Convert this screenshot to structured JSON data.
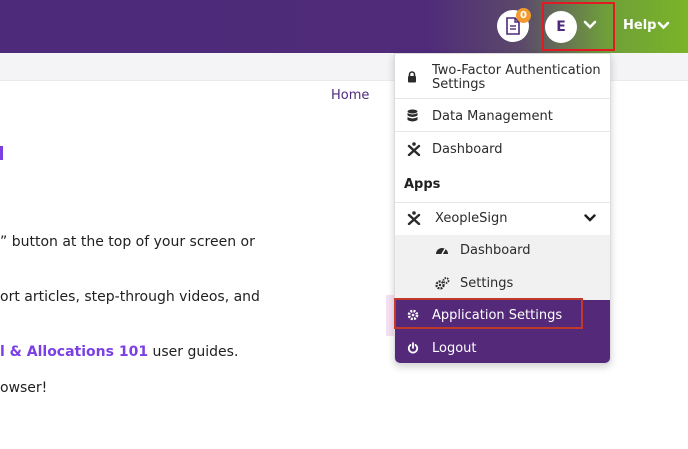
{
  "topbar": {
    "notification_count": "0",
    "user_initial": "E",
    "help_label": "Help",
    "colors": {
      "purple": "#4e2a7a",
      "green": "#7ab428",
      "badge": "#f29a2e",
      "highlight_border": "#e01b24"
    },
    "icons": [
      "document-icon",
      "chevron-down-icon"
    ]
  },
  "breadcrumb": {
    "home": "Home"
  },
  "content": {
    "line1": "” button at the top of your screen or",
    "line2": "ort articles, step-through videos, and",
    "line3_link": "l & Allocations 101",
    "line3_rest": " user guides.",
    "line4": "owser!"
  },
  "menu": {
    "two_factor": "Two-Factor Authentication Settings",
    "data_management": "Data Management",
    "dashboard": "Dashboard",
    "apps_header": "Apps",
    "xeoplesign": "XeopleSign",
    "xeoplesign_dashboard": "Dashboard",
    "xeoplesign_settings": "Settings",
    "application_settings": "Application Settings",
    "logout": "Logout",
    "icons": [
      "lock-icon",
      "database-icon",
      "xeople-logo-icon",
      "gauge-icon",
      "cogs-icon",
      "gear-icon",
      "power-icon"
    ]
  }
}
